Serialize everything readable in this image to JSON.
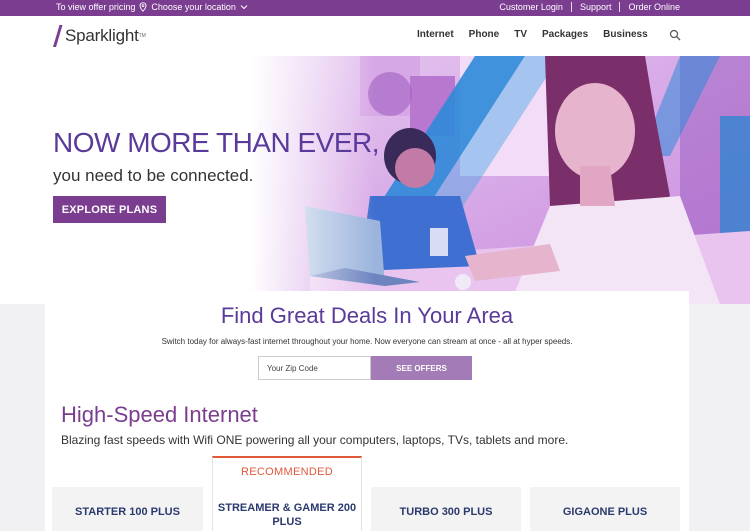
{
  "topbar": {
    "offer_text": "To view offer pricing",
    "location_link": "Choose your location",
    "links": [
      "Customer Login",
      "Support",
      "Order Online"
    ]
  },
  "nav": {
    "logo_text": "Sparklight",
    "logo_mark": "TM",
    "items": [
      "Internet",
      "Phone",
      "TV",
      "Packages",
      "Business"
    ]
  },
  "hero": {
    "title": "NOW MORE THAN EVER,",
    "subtitle": "you need to be connected.",
    "cta": "EXPLORE PLANS"
  },
  "deals": {
    "title": "Find Great Deals In Your Area",
    "subtitle": "Switch today for always-fast internet throughout your home. Now everyone can stream at once - all at hyper speeds.",
    "zip_placeholder": "Your Zip Code",
    "submit": "SEE OFFERS"
  },
  "internet": {
    "title": "High-Speed Internet",
    "subtitle": "Blazing fast speeds with Wifi ONE powering all your computers, laptops, TVs, tablets and more."
  },
  "plans": [
    {
      "name": "STARTER 100 PLUS"
    },
    {
      "name": "STREAMER & GAMER 200 PLUS",
      "badge": "RECOMMENDED"
    },
    {
      "name": "TURBO 300 PLUS"
    },
    {
      "name": "GIGAONE PLUS"
    }
  ],
  "colors": {
    "brand_purple": "#7b3d8f",
    "heading_purple": "#5a3a9a",
    "button_light": "#a37bb6",
    "recommended": "#e05a3a",
    "plan_text": "#2b3a6e"
  }
}
